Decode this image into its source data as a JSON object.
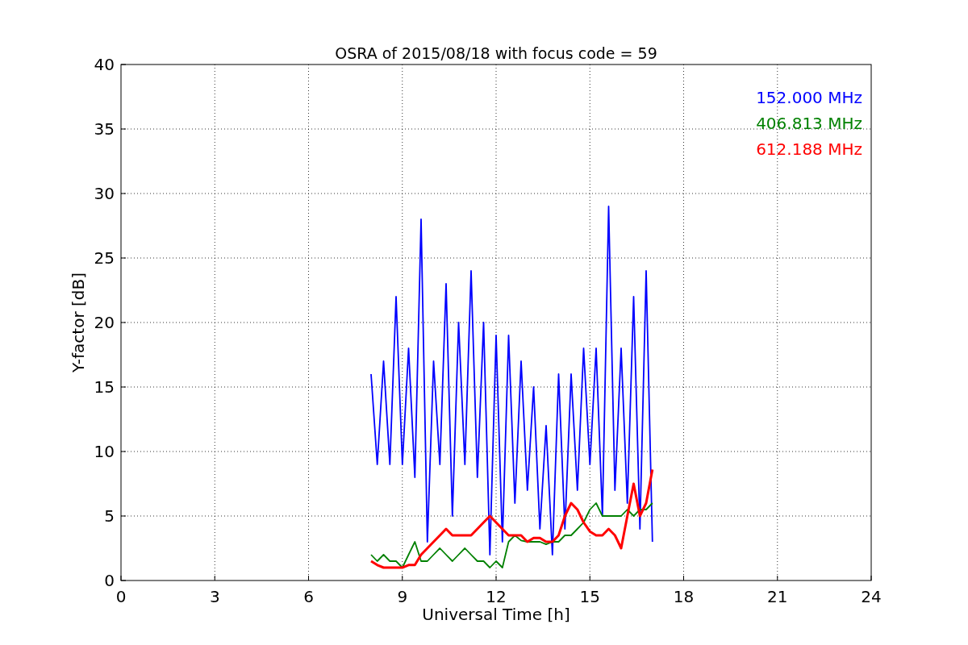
{
  "figure": {
    "chart_data": {
      "type": "line",
      "title": "OSRA of 2015/08/18 with focus code = 59",
      "xlabel": "Universal Time [h]",
      "ylabel": "Y-factor [dB]",
      "xlim": [
        0,
        24
      ],
      "ylim": [
        0,
        40
      ],
      "grid": true,
      "xticks": [
        0,
        3,
        6,
        9,
        12,
        15,
        18,
        21,
        24
      ],
      "yticks": [
        0,
        5,
        10,
        15,
        20,
        25,
        30,
        35,
        40
      ],
      "x": [
        8.0,
        8.2,
        8.4,
        8.6,
        8.8,
        9.0,
        9.2,
        9.4,
        9.6,
        9.8,
        10.0,
        10.2,
        10.4,
        10.6,
        10.8,
        11.0,
        11.2,
        11.4,
        11.6,
        11.8,
        12.0,
        12.2,
        12.4,
        12.6,
        12.8,
        13.0,
        13.2,
        13.4,
        13.6,
        13.8,
        14.0,
        14.2,
        14.4,
        14.6,
        14.8,
        15.0,
        15.2,
        15.4,
        15.6,
        15.8,
        16.0,
        16.2,
        16.4,
        16.6,
        16.8,
        17.0
      ],
      "series": [
        {
          "name": "152.000 MHz",
          "color": "#0000ff",
          "values": [
            16,
            9,
            17,
            9,
            22,
            9,
            18,
            8,
            28,
            3,
            17,
            9,
            23,
            5,
            20,
            9,
            24,
            8,
            20,
            2,
            19,
            3,
            19,
            6,
            17,
            7,
            15,
            4,
            12,
            2,
            16,
            4,
            16,
            7,
            18,
            9,
            18,
            5,
            29,
            7,
            18,
            6,
            22,
            4,
            24,
            3
          ]
        },
        {
          "name": "406.813 MHz",
          "color": "#008000",
          "values": [
            2,
            1.5,
            2,
            1.5,
            1.5,
            1,
            2,
            3,
            1.5,
            1.5,
            2,
            2.5,
            2,
            1.5,
            2,
            2.5,
            2,
            1.5,
            1.5,
            1,
            1.5,
            1,
            3,
            3.5,
            3.1,
            3,
            3,
            3,
            2.8,
            3,
            3,
            3.5,
            3.5,
            4,
            4.5,
            5.5,
            6,
            5,
            5,
            5,
            5,
            5.5,
            5,
            5.5,
            5.5,
            6
          ]
        },
        {
          "name": "612.188 MHz",
          "color": "#ff0000",
          "values": [
            1.5,
            1.2,
            1,
            1,
            1,
            1,
            1.2,
            1.2,
            2,
            2.5,
            3,
            3.5,
            4,
            3.5,
            3.5,
            3.5,
            3.5,
            4,
            4.5,
            5,
            4.5,
            4,
            3.5,
            3.5,
            3.5,
            3,
            3.3,
            3.3,
            3,
            3,
            3.5,
            5,
            6,
            5.5,
            4.5,
            3.8,
            3.5,
            3.5,
            4,
            3.5,
            2.5,
            5,
            7.5,
            5,
            6,
            8.6
          ]
        }
      ]
    }
  }
}
